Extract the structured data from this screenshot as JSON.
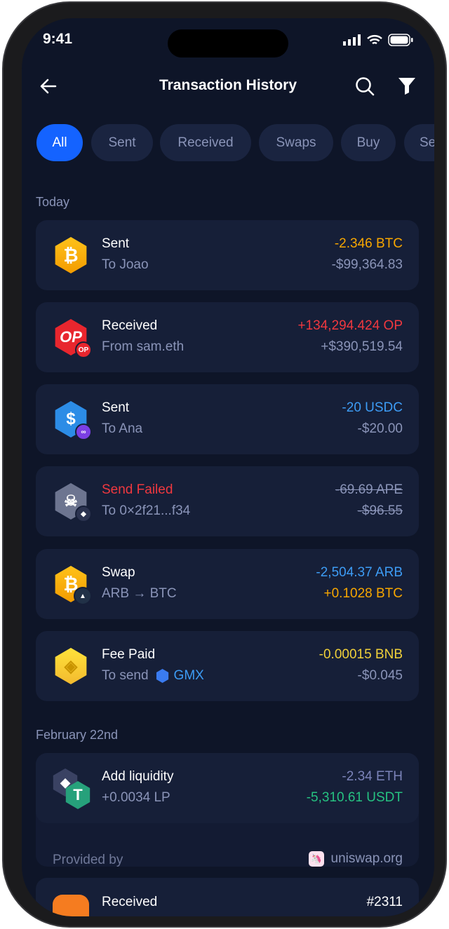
{
  "status": {
    "time": "9:41"
  },
  "header": {
    "title": "Transaction History",
    "back_icon": "arrow-left-icon",
    "search_icon": "search-icon",
    "filter_icon": "filter-icon"
  },
  "filters": [
    {
      "label": "All",
      "active": true
    },
    {
      "label": "Sent"
    },
    {
      "label": "Received"
    },
    {
      "label": "Swaps"
    },
    {
      "label": "Buy"
    },
    {
      "label": "Se"
    }
  ],
  "sections": [
    {
      "label": "Today",
      "items": [
        {
          "title": "Sent",
          "subtitle": "To Joao",
          "amount": "-2.346 BTC",
          "fiat": "-$99,364.83",
          "amount_color": "#f7a600",
          "icon": "bitcoin-icon"
        },
        {
          "title": "Received",
          "subtitle": "From sam.eth",
          "amount": "+134,294.424 OP",
          "fiat": "+$390,519.54",
          "amount_color": "#f0383f",
          "icon": "optimism-icon"
        },
        {
          "title": "Sent",
          "subtitle": "To Ana",
          "amount": "-20 USDC",
          "fiat": "-$20.00",
          "amount_color": "#3d9cf5",
          "icon": "usdc-icon"
        },
        {
          "title": "Send Failed",
          "subtitle": "To 0×2f21...f34",
          "amount": "-69.69 APE",
          "fiat": "-$96.55",
          "amount_color": "#8a94b8",
          "title_color": "#f0383f",
          "icon": "ape-icon"
        },
        {
          "title": "Swap",
          "subtitle": "ARB → BTC",
          "amount": "-2,504.37 ARB",
          "fiat": "+0.1028 BTC",
          "amount_color": "#3d9cf5",
          "fiat_color": "#f7a600",
          "icon": "bitcoin-arbitrum-icon"
        },
        {
          "title": "Fee Paid",
          "subtitle": "To send",
          "subtitle_token": "GMX",
          "amount": "-0.00015 BNB",
          "fiat": "-$0.045",
          "amount_color": "#f0d03a",
          "icon": "bnb-icon"
        }
      ]
    },
    {
      "label": "February 22nd",
      "items": [
        {
          "title": "Add liquidity",
          "subtitle": "+0.0034 LP",
          "amount": "-2.34 ETH",
          "fiat": "-5,310.61 USDT",
          "amount_color": "#7b83b9",
          "fiat_color": "#26c281",
          "provided_label": "Provided by",
          "provider": "uniswap.org",
          "icon": "eth-usdt-icon"
        },
        {
          "title": "Received",
          "amount": "#2311",
          "icon": "nft-icon"
        }
      ]
    }
  ]
}
